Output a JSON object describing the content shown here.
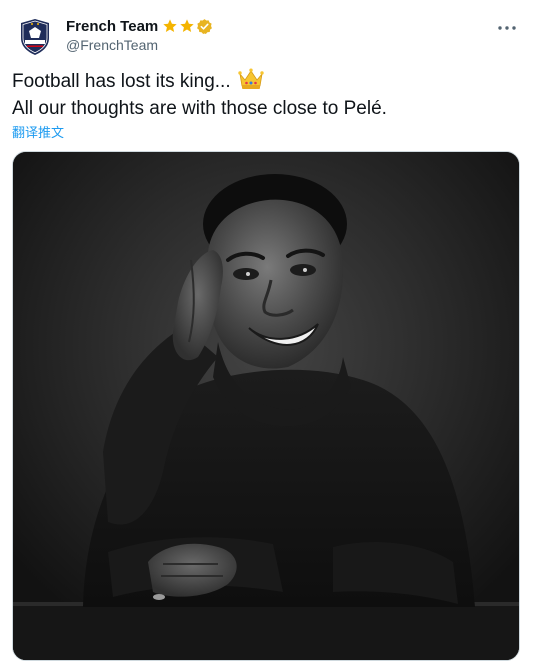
{
  "account": {
    "display_name": "French Team",
    "handle": "@FrenchTeam",
    "avatar_icon": "fff-crest-icon",
    "badges": [
      "gold-star-icon",
      "gold-star-icon",
      "verified-gold-icon"
    ]
  },
  "tweet": {
    "line1": "Football has lost its king...",
    "line1_emoji": "crown-emoji",
    "line2": "All our thoughts are with those close to Pelé.",
    "translate_label": "翻译推文"
  },
  "media": {
    "kind": "black-and-white portrait photo"
  },
  "colors": {
    "link_blue": "#1d9bf0",
    "secondary_text": "#536471",
    "gold": "#f4b400",
    "federation_blue": "#1f2d5a"
  }
}
